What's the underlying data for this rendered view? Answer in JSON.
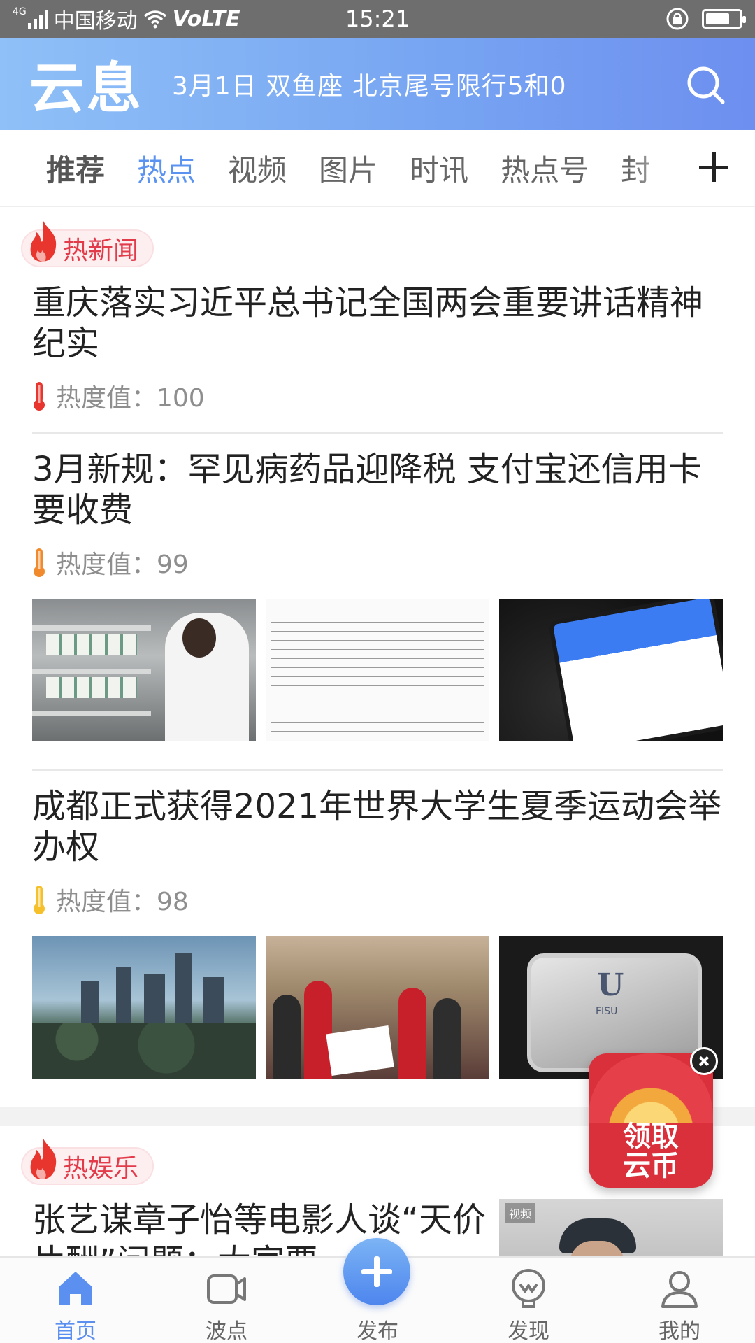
{
  "status_bar": {
    "network_tag": "4G",
    "carrier": "中国移动",
    "volte": "VoLTE",
    "time": "15:21",
    "battery_level": 0.72
  },
  "header": {
    "logo": "云息",
    "info": "3月1日 双鱼座  北京尾号限行5和0",
    "gradient_colors": [
      "#8fc0f7",
      "#6d8ff0"
    ]
  },
  "tabs": [
    {
      "label": "推荐"
    },
    {
      "label": "热点"
    },
    {
      "label": "视频"
    },
    {
      "label": "图片"
    },
    {
      "label": "时讯"
    },
    {
      "label": "热点号"
    },
    {
      "label": "封"
    }
  ],
  "sections": {
    "hot_news": {
      "badge": "热新闻",
      "items": [
        {
          "title": "重庆落实习近平总书记全国两会重要讲话精神纪实",
          "heat": "热度值：100",
          "heat_color": "#e8362f"
        },
        {
          "title": "3月新规：罕见病药品迎降税 支付宝还信用卡要收费",
          "heat": "热度值：99",
          "heat_color": "#f08a2c"
        },
        {
          "title": "成都正式获得2021年世界大学生夏季运动会举办权",
          "heat": "热度值：98",
          "heat_color": "#f5c02a"
        }
      ]
    },
    "hot_ent": {
      "badge": "热娱乐",
      "item": {
        "title": "张艺谋章子怡等电影人谈“天价片酬”问题：大家要一律",
        "thumb_tag": "视频"
      }
    }
  },
  "thumbnails": {
    "plaque_u": "U",
    "plaque_fisu": "FISU"
  },
  "coin_float": {
    "line1": "领取",
    "line2": "云币"
  },
  "bottom_nav": [
    {
      "label": "首页",
      "icon": "home-icon"
    },
    {
      "label": "波点",
      "icon": "video-icon"
    },
    {
      "label": "发布",
      "icon": "plus-icon"
    },
    {
      "label": "发现",
      "icon": "discover-icon"
    },
    {
      "label": "我的",
      "icon": "profile-icon"
    }
  ],
  "colors": {
    "accent": "#5b93f0",
    "hot_red": "#e23b4a"
  }
}
